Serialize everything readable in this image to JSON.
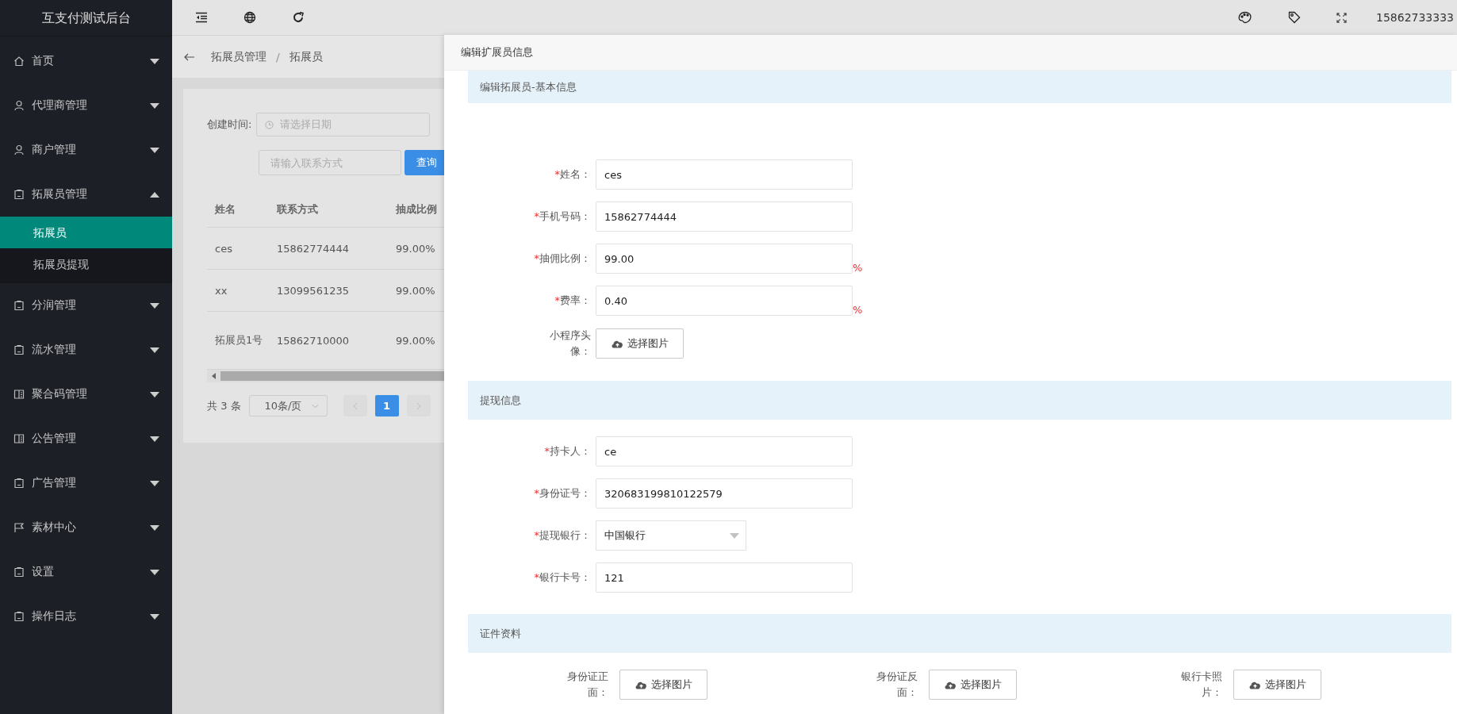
{
  "app_title": "互支付测试后台",
  "sidebar": {
    "items": [
      {
        "label": "首页",
        "expanded": false
      },
      {
        "label": "代理商管理",
        "expanded": false
      },
      {
        "label": "商户管理",
        "expanded": false
      },
      {
        "label": "拓展员管理",
        "expanded": true,
        "children": [
          {
            "label": "拓展员",
            "selected": true
          },
          {
            "label": "拓展员提现",
            "selected": false
          }
        ]
      },
      {
        "label": "分润管理",
        "expanded": false
      },
      {
        "label": "流水管理",
        "expanded": false
      },
      {
        "label": "聚合码管理",
        "expanded": false
      },
      {
        "label": "公告管理",
        "expanded": false
      },
      {
        "label": "广告管理",
        "expanded": false
      },
      {
        "label": "素材中心",
        "expanded": false
      },
      {
        "label": "设置",
        "expanded": false
      },
      {
        "label": "操作日志",
        "expanded": false
      }
    ]
  },
  "topbar": {
    "user": "15862733333"
  },
  "breadcrumb": {
    "items": [
      "拓展员管理",
      "拓展员"
    ],
    "separator": "/"
  },
  "filters": {
    "date_label": "创建时间:",
    "date_placeholder": "请选择日期",
    "contact_placeholder": "请输入联系方式",
    "query_button": "查询"
  },
  "table": {
    "columns": [
      "姓名",
      "联系方式",
      "抽成比例"
    ],
    "rows": [
      [
        "ces",
        "15862774444",
        "99.00%"
      ],
      [
        "xx",
        "13099561235",
        "99.00%"
      ],
      [
        "拓展员1号",
        "15862710000",
        "99.00%"
      ]
    ]
  },
  "pagination": {
    "total": "共 3 条",
    "page_size": "10条/页",
    "pages": [
      {
        "label": "1",
        "selected": true
      }
    ]
  },
  "drawer": {
    "title": "编辑扩展员信息",
    "sections": [
      {
        "title": "编辑拓展员-基本信息",
        "kind": "rows",
        "fields": [
          {
            "kind": "input",
            "required_mark": "*",
            "label": "姓名：",
            "value": "ces"
          },
          {
            "kind": "input",
            "required_mark": "*",
            "label": "手机号码：",
            "value": "15862774444"
          },
          {
            "kind": "input",
            "required_mark": "*",
            "label": "抽佣比例：",
            "value": "99.00",
            "suffix": "%"
          },
          {
            "kind": "input",
            "required_mark": "*",
            "label": "费率：",
            "value": "0.40",
            "suffix": "%"
          },
          {
            "kind": "upload",
            "label": "小程序头像：",
            "button": "选择图片"
          }
        ]
      },
      {
        "title": "提现信息",
        "kind": "rows",
        "fields": [
          {
            "kind": "input",
            "required_mark": "*",
            "label": "持卡人：",
            "value": "ce"
          },
          {
            "kind": "input",
            "required_mark": "*",
            "label": "身份证号：",
            "value": "320683199810122579"
          },
          {
            "kind": "select",
            "required_mark": "*",
            "label": "提现银行：",
            "value": "中国银行"
          },
          {
            "kind": "input",
            "required_mark": "*",
            "label": "银行卡号：",
            "value": "121"
          }
        ]
      },
      {
        "title": "证件资料",
        "kind": "columns",
        "fields": [
          {
            "kind": "upload",
            "label": "身份证正面：",
            "button": "选择图片"
          },
          {
            "kind": "upload",
            "label": "身份证反面：",
            "button": "选择图片"
          },
          {
            "kind": "upload",
            "label": "银行卡照片：",
            "button": "选择图片"
          }
        ]
      }
    ]
  }
}
